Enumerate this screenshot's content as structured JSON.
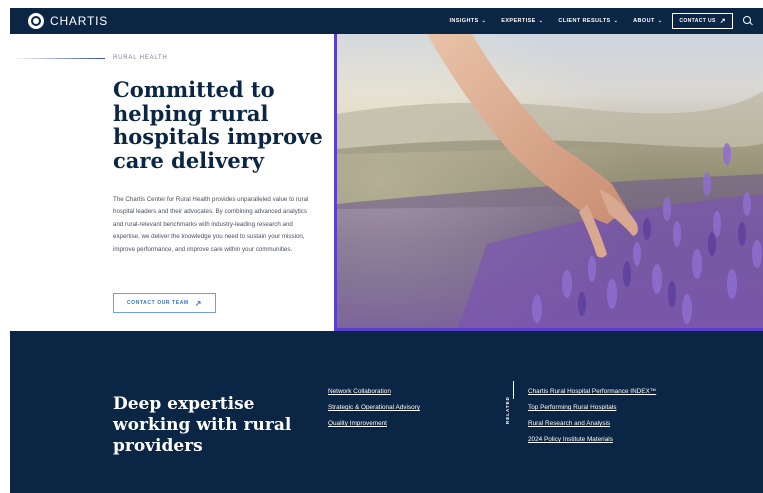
{
  "brand": {
    "name": "CHARTIS"
  },
  "nav": {
    "items": [
      "INSIGHTS",
      "EXPERTISE",
      "CLIENT RESULTS",
      "ABOUT"
    ],
    "contact_label": "CONTACT US",
    "search_icon": "search-icon",
    "arrow_icon": "arrow-up-right-icon"
  },
  "hero": {
    "eyebrow": "RURAL HEALTH",
    "title": "Committed to helping rural hospitals improve care delivery",
    "body": "The Chartis Center for Rural Health provides unparalleled value to rural hospital leaders and their advocates. By combining advanced analytics and rural-relevant benchmarks with industry-leading research and expertise, we deliver the knowledge you need to sustain your mission, improve performance, and improve care within your communities.",
    "cta_label": "CONTACT OUR TEAM"
  },
  "expertise": {
    "title": "Deep expertise working with rural providers",
    "links": [
      "Network Collaboration",
      "Strategic & Operational Advisory",
      "Quality Improvement"
    ],
    "related_label": "RELATED",
    "related_links": [
      "Chartis Rural Hospital Performance INDEX™",
      "Top Performing Rural Hospitals",
      "Rural Research and Analysis",
      "2024 Policy Institute Materials"
    ]
  },
  "colors": {
    "navy": "#0b2644",
    "accent_purple": "#5a3fcf",
    "link_blue": "#3a78b8"
  }
}
